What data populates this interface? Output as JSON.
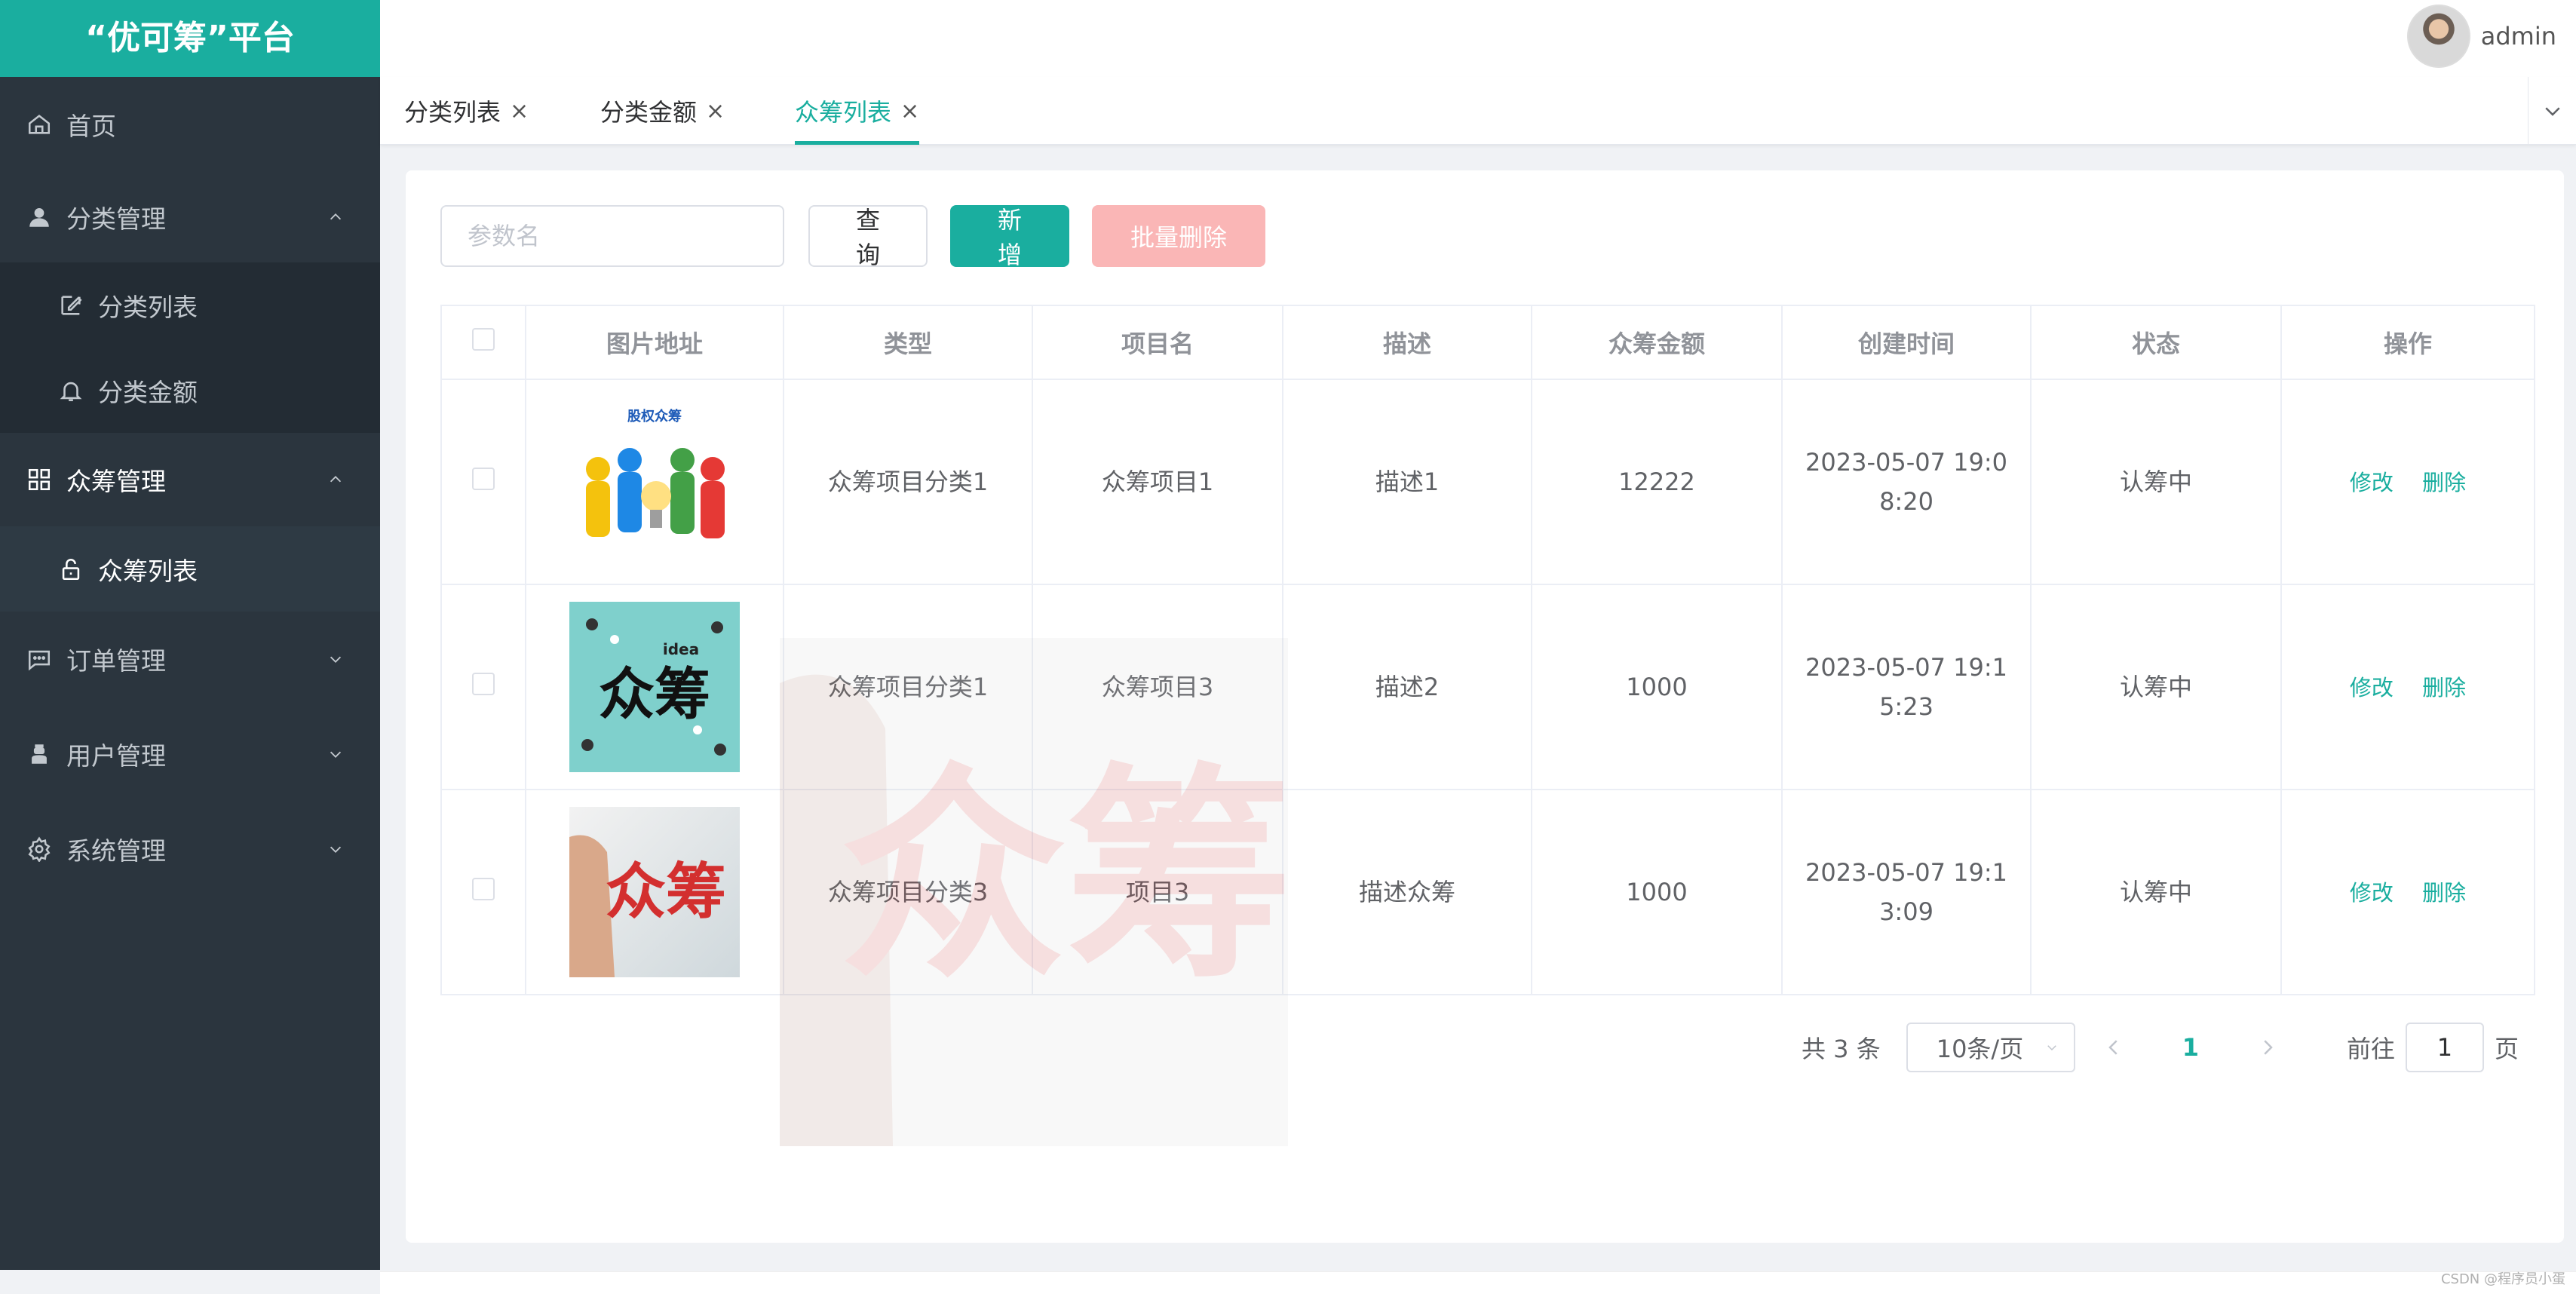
{
  "app": {
    "logo_text": "“优可筹”平台"
  },
  "header": {
    "username": "admin"
  },
  "sidebar": {
    "items": [
      {
        "label": "首页",
        "icon": "home-icon"
      },
      {
        "label": "分类管理",
        "icon": "user-icon"
      },
      {
        "label": "分类列表",
        "icon": "edit-icon"
      },
      {
        "label": "分类金额",
        "icon": "bell-icon"
      },
      {
        "label": "众筹管理",
        "icon": "grid-icon"
      },
      {
        "label": "众筹列表",
        "icon": "unlock-icon"
      },
      {
        "label": "订单管理",
        "icon": "chat-icon"
      },
      {
        "label": "用户管理",
        "icon": "person-icon"
      },
      {
        "label": "系统管理",
        "icon": "gear-icon"
      }
    ]
  },
  "tabs": [
    {
      "label": "分类列表"
    },
    {
      "label": "分类金额"
    },
    {
      "label": "众筹列表"
    }
  ],
  "toolbar": {
    "search_placeholder": "参数名",
    "query_label": "查询",
    "add_label": "新增",
    "batch_delete_label": "批量删除"
  },
  "table": {
    "headers": [
      "图片地址",
      "类型",
      "项目名",
      "描述",
      "众筹金额",
      "创建时间",
      "状态",
      "操作"
    ],
    "rows": [
      {
        "type": "众筹项目分类1",
        "name": "众筹项目1",
        "desc": "描述1",
        "amount": "12222",
        "created": "2023-05-07 19:08:20",
        "status": "认筹中"
      },
      {
        "type": "众筹项目分类1",
        "name": "众筹项目3",
        "desc": "描述2",
        "amount": "1000",
        "created": "2023-05-07 19:15:23",
        "status": "认筹中"
      },
      {
        "type": "众筹项目分类3",
        "name": "项目3",
        "desc": "描述众筹",
        "amount": "1000",
        "created": "2023-05-07 19:13:09",
        "status": "认筹中"
      }
    ],
    "edit_label": "修改",
    "delete_label": "删除",
    "img1_text": "股权众筹",
    "img2_text": "众筹",
    "img2_sub": "idea",
    "img3_text": "众筹"
  },
  "pagination": {
    "total": "共 3 条",
    "page_size": "10条/页",
    "current_page": "1",
    "goto_label": "前往",
    "goto_value": "1",
    "page_suffix": "页"
  },
  "watermark_text": "众筹",
  "credit": "CSDN @程序员小蛋",
  "colors": {
    "accent": "#1aae9f",
    "sidebar": "#2b353e",
    "danger_light": "#fab6b6"
  }
}
